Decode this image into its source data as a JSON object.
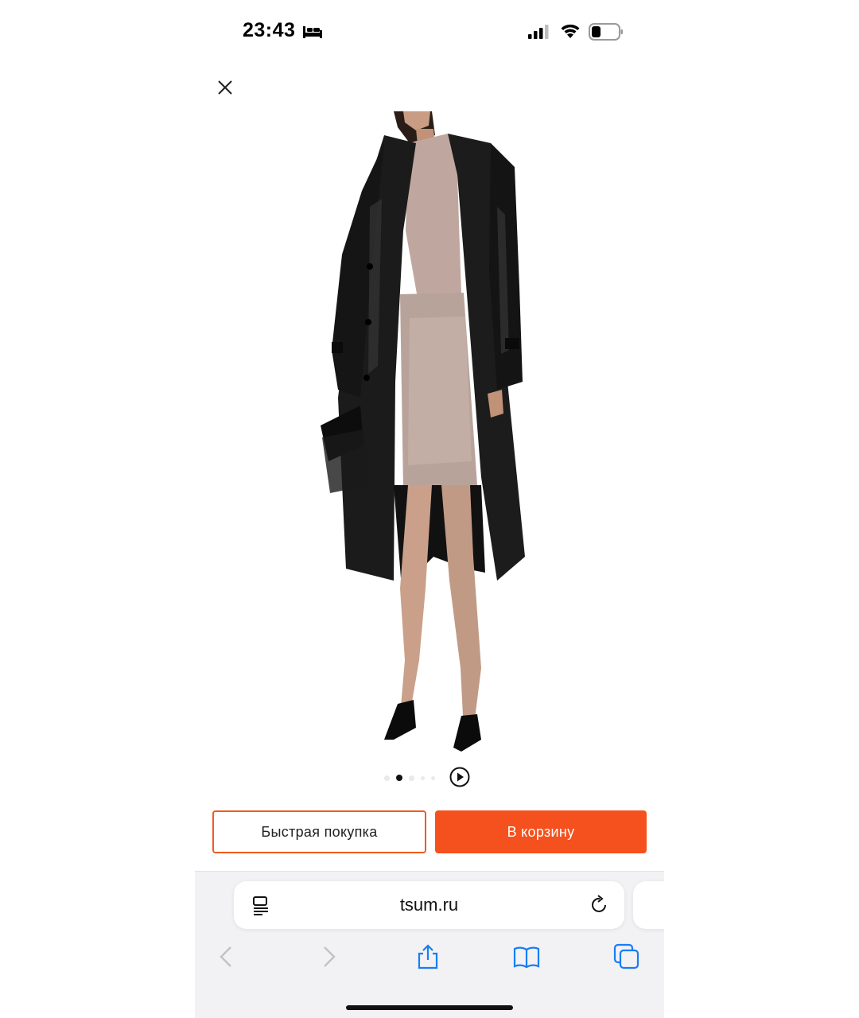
{
  "status_bar": {
    "time": "23:43",
    "icons": [
      "bed-icon",
      "signal-icon",
      "wifi-icon",
      "battery-icon"
    ]
  },
  "product": {
    "image_alt": "",
    "carousel": {
      "count": 5,
      "active_index": 1,
      "video_icon": "play-icon"
    }
  },
  "actions": {
    "quick_buy_label": "Быстрая покупка",
    "add_to_cart_label": "В корзину"
  },
  "browser": {
    "address": "tsum.ru",
    "toolbar": [
      "back-icon",
      "forward-icon",
      "share-icon",
      "bookmarks-icon",
      "tabs-icon"
    ]
  },
  "colors": {
    "accent": "#f4511e",
    "accent_border": "#f15a22",
    "toolbar_blue": "#1a7cf5"
  }
}
